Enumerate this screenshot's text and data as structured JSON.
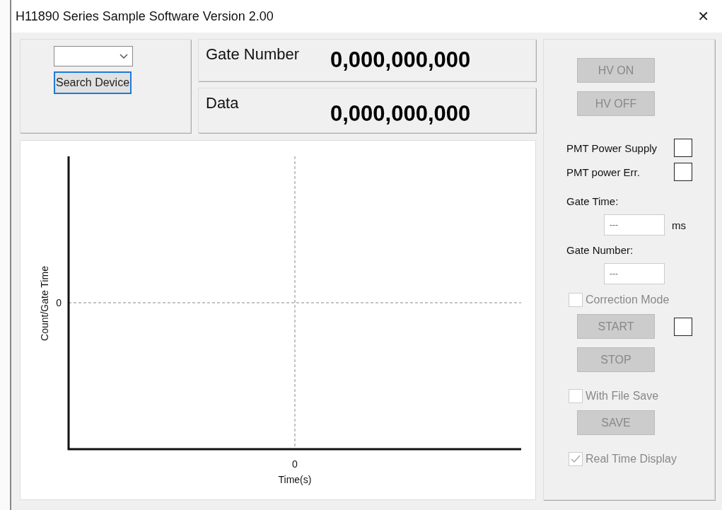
{
  "window": {
    "title": "H11890 Series Sample Software Version 2.00",
    "close": "✕"
  },
  "device": {
    "search_button": {
      "label": "Search Device",
      "focused": true
    }
  },
  "readouts": [
    {
      "label": "Gate Number",
      "value": "0,000,000,000"
    },
    {
      "label": "Data",
      "value": "0,000,000,000"
    }
  ],
  "chart": {
    "ylabel": "Count/Gate Time",
    "xlabel": "Time(s)",
    "y_tick": "0",
    "x_tick": "0"
  },
  "controls": [
    {
      "kind": "button",
      "label": "HV ON",
      "disabled": true
    },
    {
      "kind": "button",
      "label": "HV OFF",
      "disabled": true
    },
    {
      "kind": "indicator",
      "label": "PMT Power Supply",
      "on": false
    },
    {
      "kind": "indicator",
      "label": "PMT power Err.",
      "on": false
    },
    {
      "kind": "field",
      "label": "Gate Time:",
      "value": "---",
      "unit": "ms"
    },
    {
      "kind": "field",
      "label": "Gate Number:",
      "value": "---"
    },
    {
      "kind": "checkbox",
      "label": "Correction Mode",
      "checked": false,
      "disabled": true
    },
    {
      "kind": "button",
      "label": "START",
      "disabled": true,
      "indicator_on": false
    },
    {
      "kind": "button",
      "label": "STOP",
      "disabled": true
    },
    {
      "kind": "checkbox",
      "label": "With File Save",
      "checked": false,
      "disabled": true
    },
    {
      "kind": "button",
      "label": "SAVE",
      "disabled": true
    },
    {
      "kind": "checkbox",
      "label": "Real Time Display",
      "checked": true,
      "disabled": true
    }
  ]
}
